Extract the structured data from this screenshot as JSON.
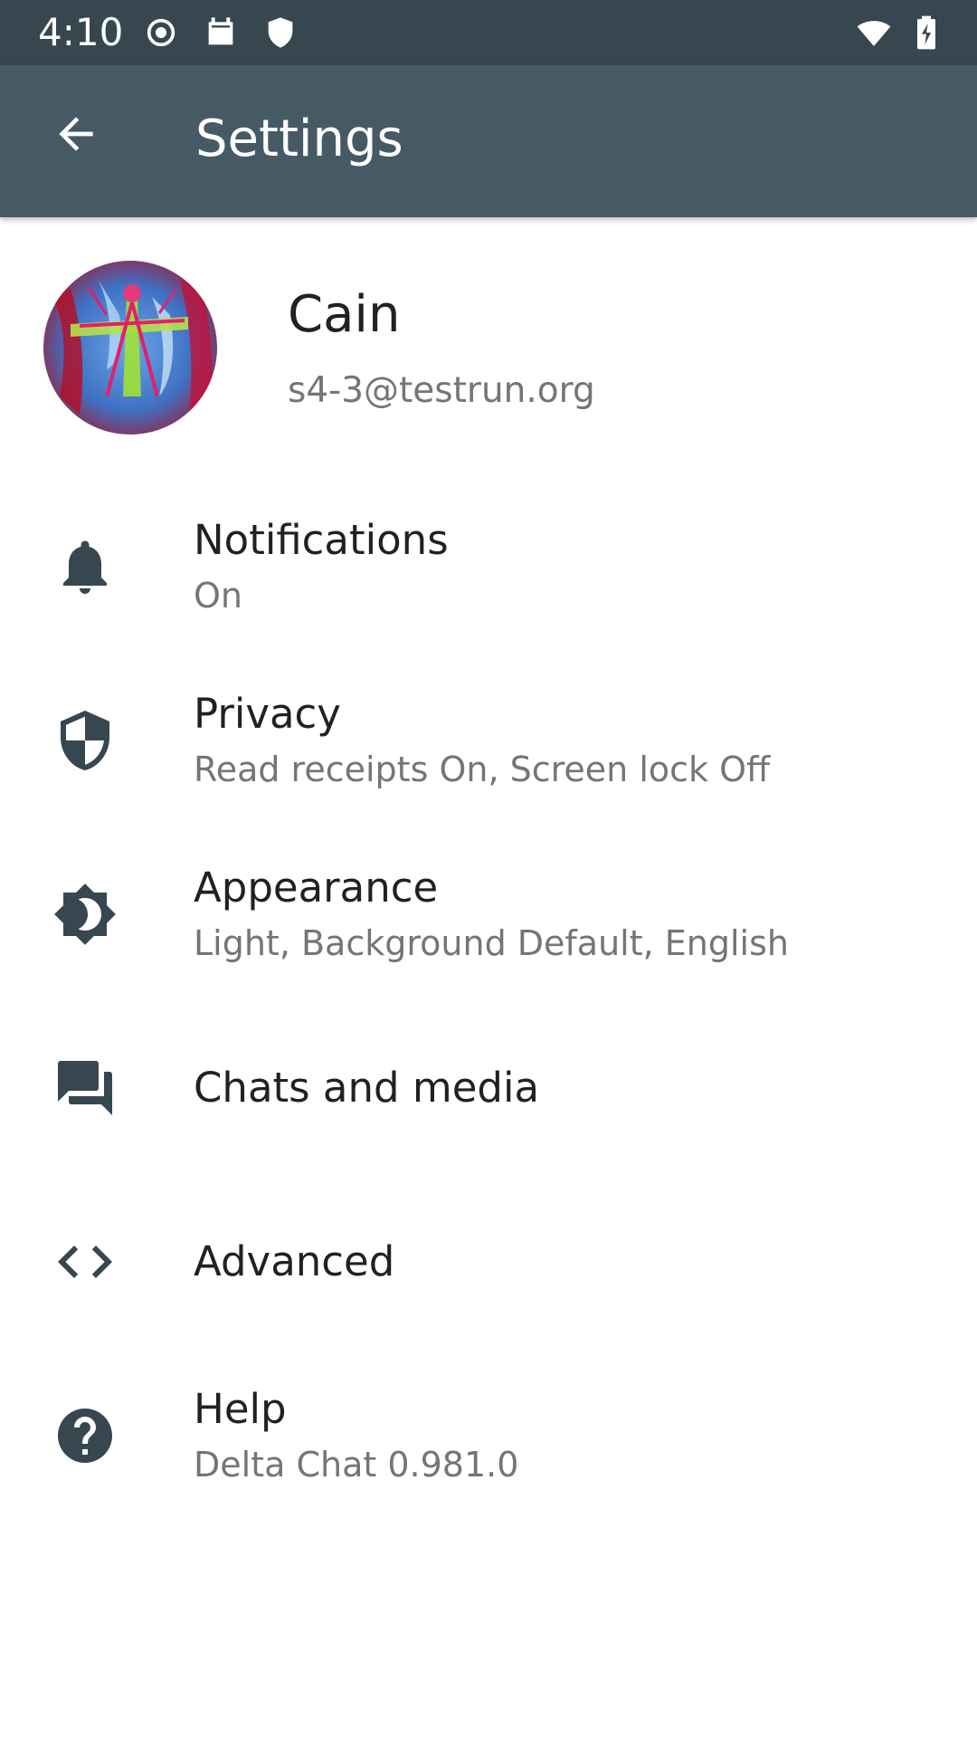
{
  "status_bar": {
    "time": "4:10",
    "icons": [
      "record-icon",
      "calendar-icon",
      "shield-icon",
      "wifi-icon",
      "battery-icon"
    ]
  },
  "app_bar": {
    "title": "Settings",
    "back_icon": "arrow-back-icon",
    "color": "#455a64"
  },
  "profile": {
    "name": "Cain",
    "email": "s4-3@testrun.org"
  },
  "settings": [
    {
      "title": "Notifications",
      "summary": "On",
      "icon": "bell-icon"
    },
    {
      "title": "Privacy",
      "summary": "Read receipts On, Screen lock Off",
      "icon": "shield-icon"
    },
    {
      "title": "Appearance",
      "summary": "Light, Background Default, English",
      "icon": "brightness-icon"
    },
    {
      "title": "Chats and media",
      "summary": "",
      "icon": "chat-icon"
    },
    {
      "title": "Advanced",
      "summary": "",
      "icon": "code-icon"
    },
    {
      "title": "Help",
      "summary": "Delta Chat 0.981.0",
      "icon": "help-icon"
    }
  ],
  "colors": {
    "status_bar": "#37474f",
    "icon": "#37474f",
    "primary_text": "#212121",
    "secondary_text": "#757575"
  }
}
